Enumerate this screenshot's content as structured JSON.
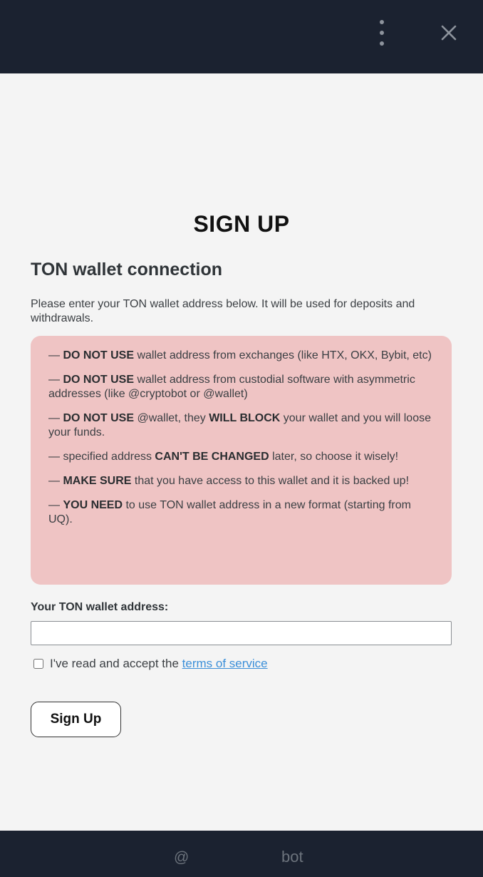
{
  "header": {
    "menu_icon": "more-vertical-icon",
    "close_icon": "close-icon"
  },
  "page": {
    "title": "SIGN UP",
    "section_title": "TON wallet connection",
    "intro": "Please enter your TON wallet address below. It will be used for deposits and withdrawals."
  },
  "warnings": [
    {
      "prefix": "— ",
      "bold": "DO NOT USE",
      "rest": " wallet address from exchanges (like HTX, OKX, Bybit, etc)"
    },
    {
      "prefix": "— ",
      "bold": "DO NOT USE",
      "rest": " wallet address from custodial software with asymmetric addresses (like @cryptobot or @wallet)"
    },
    {
      "prefix": "— ",
      "bold": "DO NOT USE",
      "mid": " @wallet, they ",
      "bold2": "WILL BLOCK",
      "rest": " your wallet and you will loose your funds."
    },
    {
      "prefix": "— specified address ",
      "bold": "CAN'T BE CHANGED",
      "rest": " later, so choose it wisely!"
    },
    {
      "prefix": "— ",
      "bold": "MAKE SURE",
      "rest": " that you have access to this wallet and it is backed up!"
    },
    {
      "prefix": "— ",
      "bold": "YOU NEED",
      "rest": " to use TON wallet address in a new format (starting from UQ)."
    }
  ],
  "form": {
    "address_label": "Your TON wallet address:",
    "address_value": "",
    "address_placeholder": "",
    "terms_text": "I've read and accept the ",
    "terms_link": "terms of service",
    "terms_checked": false,
    "signup_label": "Sign Up"
  },
  "footer": {
    "at": "@",
    "bot": "bot"
  },
  "colors": {
    "bar": "#1b2230",
    "warning_bg": "#efc4c4",
    "link": "#3b8fd9"
  }
}
